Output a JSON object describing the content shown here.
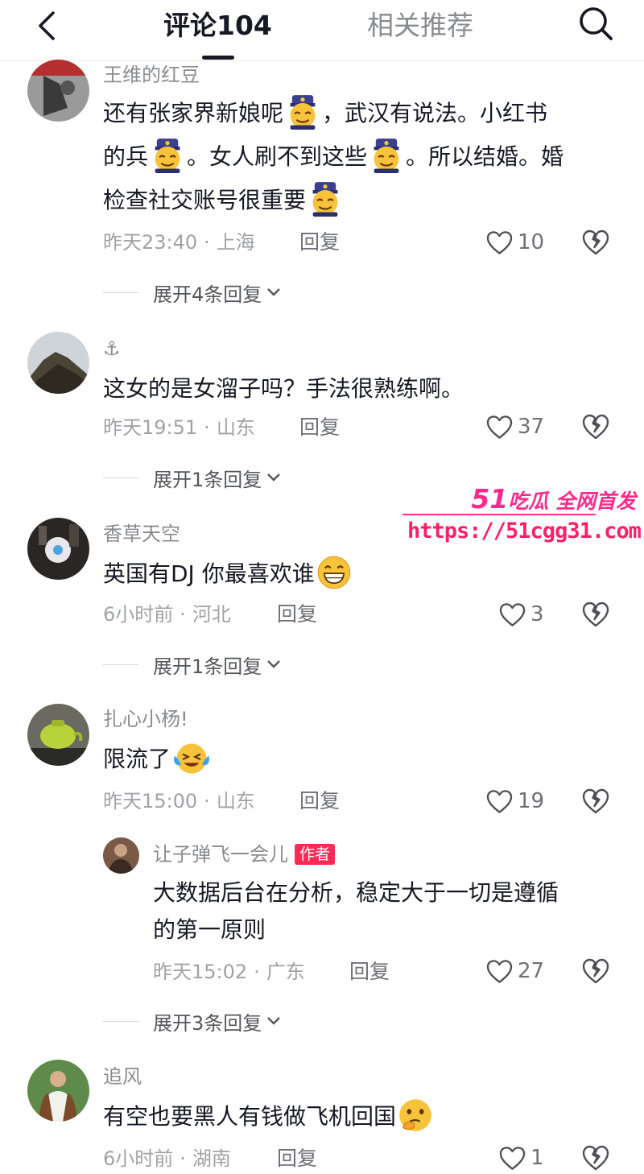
{
  "header": {
    "tab_comments": "评论104",
    "tab_related": "相关推荐",
    "back_icon": "chevron-left-icon",
    "search_icon": "search-icon"
  },
  "comments": [
    {
      "user": "王维的红豆",
      "lines": [
        "还有张家界新娘呢",
        "，武汉有说法。小红书",
        "的兵",
        "。女人刷不到这些",
        "。所以结婚。婚",
        "检查社交账号很重要"
      ],
      "emoji": "smirk-soldier-emoji",
      "time": "昨天23:40",
      "location": "上海",
      "reply": "回复",
      "likes": "10",
      "expand": "展开4条回复"
    },
    {
      "user": "⚓",
      "text": "这女的是女溜子吗？手法很熟练啊。",
      "time": "昨天19:51",
      "location": "山东",
      "reply": "回复",
      "likes": "37",
      "expand": "展开1条回复"
    },
    {
      "user": "香草天空",
      "text": "英国有DJ 你最喜欢谁",
      "emoji": "grin-emoji",
      "time": "6小时前",
      "location": "河北",
      "reply": "回复",
      "likes": "3",
      "expand": "展开1条回复"
    },
    {
      "user": "扎心小杨!",
      "text": "限流了",
      "emoji": "crying-laugh-emoji",
      "time": "昨天15:00",
      "location": "山东",
      "reply": "回复",
      "likes": "19",
      "sub_reply": {
        "user": "让子弹飞一会儿",
        "badge": "作者",
        "line1": "大数据后台在分析，稳定大于一切是遵循",
        "line2": "的第一原则",
        "time": "昨天15:02",
        "location": "广东",
        "reply": "回复",
        "likes": "27"
      },
      "expand": "展开3条回复"
    },
    {
      "user": "追风",
      "text": "有空也要黑人有钱做飞机回国",
      "emoji": "thinking-emoji",
      "time": "6小时前",
      "location": "湖南",
      "reply": "回复",
      "likes": "1"
    }
  ],
  "watermark": {
    "brand_num": "51",
    "brand_text": "吃瓜 全网首发",
    "url": "https://51cgg31.com"
  },
  "colors": {
    "text_primary": "#161823",
    "text_secondary": "#8a8b91",
    "author_badge": "#fe2c55",
    "watermark": "#ff2a8c"
  }
}
